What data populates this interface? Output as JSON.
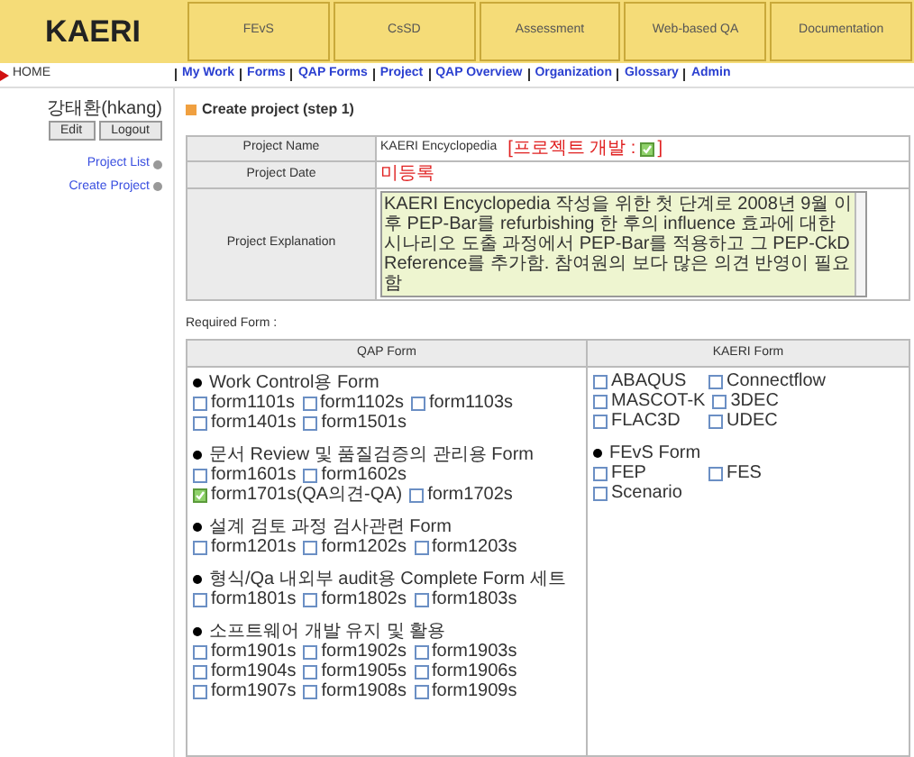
{
  "header": {
    "logo": "KAERI",
    "tabs": [
      "FEvS",
      "CsSD",
      "Assessment",
      "Web-based QA",
      "Documentation"
    ]
  },
  "nav": {
    "home": "HOME",
    "links": [
      "My Work",
      "Forms",
      "QAP Forms",
      "Project",
      "QAP Overview",
      "Organization",
      "Glossary",
      "Admin"
    ]
  },
  "sidebar": {
    "user": "강태환(hkang)",
    "buttons": [
      "Edit",
      "Logout"
    ],
    "links": [
      "Project List",
      "Create Project"
    ]
  },
  "main": {
    "title": "Create project (step 1)",
    "fields": [
      {
        "kind": "name",
        "label": "Project Name",
        "value": "KAERI Encyclopedia",
        "status_label": "[프로젝트 개발 :",
        "status_checked": true,
        "status_close": "]"
      },
      {
        "kind": "date",
        "label": "Project Date",
        "value": "미등록"
      },
      {
        "kind": "textarea",
        "label": "Project Explanation",
        "value": "KAERI Encyclopedia 작성을 위한 첫 단계로 2008년 9월 이후 PEP-Bar를 refurbishing 한 후의 influence 효과에 대한 시나리오 도출 과정에서 PEP-Bar를 적용하고 그 PEP-CkD Reference를 추가함. 참여원의 보다 많은 의견 반영이 필요함"
      }
    ]
  },
  "required_form": {
    "label": "Required Form :",
    "columns": [
      {
        "title": "QAP Form",
        "groups": [
          {
            "title": "Work Control용 Form",
            "items": [
              {
                "label": "form1101s",
                "checked": false
              },
              {
                "label": "form1102s",
                "checked": false
              },
              {
                "label": "form1103s",
                "checked": false
              },
              {
                "label": "form1401s",
                "checked": false
              },
              {
                "label": "form1501s",
                "checked": false
              }
            ]
          },
          {
            "title": "문서 Review 및 품질검증의 관리용 Form",
            "items": [
              {
                "label": "form1601s",
                "checked": false
              },
              {
                "label": "form1602s",
                "checked": false
              },
              {
                "label": "form1701s(QA의견-QA)",
                "checked": true
              },
              {
                "label": "form1702s",
                "checked": false
              }
            ]
          },
          {
            "title": "설계 검토 과정 검사관련 Form",
            "items": [
              {
                "label": "form1201s",
                "checked": false
              },
              {
                "label": "form1202s",
                "checked": false
              },
              {
                "label": "form1203s",
                "checked": false
              }
            ]
          },
          {
            "title": "형식/Qa 내외부 audit용 Complete Form 세트",
            "items": [
              {
                "label": "form1801s",
                "checked": false
              },
              {
                "label": "form1802s",
                "checked": false
              },
              {
                "label": "form1803s",
                "checked": false
              }
            ]
          },
          {
            "title": "소프트웨어 개발 유지 및 활용",
            "items": [
              {
                "label": "form1901s",
                "checked": false
              },
              {
                "label": "form1902s",
                "checked": false
              },
              {
                "label": "form1903s",
                "checked": false
              },
              {
                "label": "form1904s",
                "checked": false
              },
              {
                "label": "form1905s",
                "checked": false
              },
              {
                "label": "form1906s",
                "checked": false
              },
              {
                "label": "form1907s",
                "checked": false
              },
              {
                "label": "form1908s",
                "checked": false
              },
              {
                "label": "form1909s",
                "checked": false
              }
            ]
          }
        ]
      },
      {
        "title": "KAERI Form",
        "groups": [
          {
            "items": [
              {
                "label": "ABAQUS",
                "checked": false
              },
              {
                "label": "Connectflow",
                "checked": false
              },
              {
                "label": "MASCOT-K",
                "checked": false
              },
              {
                "label": "3DEC",
                "checked": false
              },
              {
                "label": "FLAC3D",
                "checked": false
              },
              {
                "label": "UDEC",
                "checked": false
              }
            ]
          },
          {
            "title": "FEvS Form",
            "items": [
              {
                "label": "FEP",
                "checked": false
              },
              {
                "label": "FES",
                "checked": false
              },
              {
                "label": "Scenario",
                "checked": false
              }
            ]
          }
        ]
      }
    ]
  }
}
